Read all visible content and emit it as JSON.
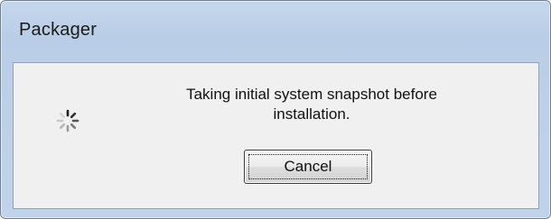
{
  "window": {
    "title": "Packager"
  },
  "dialog": {
    "message_line1": "Taking initial system snapshot before",
    "message_line2": "installation.",
    "cancel_label": "Cancel",
    "spinner_icon": "busy-spinner-icon"
  }
}
